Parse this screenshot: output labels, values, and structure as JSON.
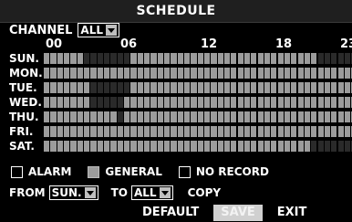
{
  "title": "SCHEDULE",
  "channel": {
    "label": "CHANNEL",
    "value": "ALL"
  },
  "hours": [
    "00",
    "06",
    "12",
    "18",
    "23"
  ],
  "days": [
    {
      "label": "SUN.",
      "cells": "GGGGGGAAAAAAAGGGGGGGGGGGGGGGGGGGGGGGGGGGGAAAAAA"
    },
    {
      "label": "MON.",
      "cells": "GGGGGGGGGGGGGGGGGGGGGGGGGGGGGGGGGGGGGGGGGGGGGGG"
    },
    {
      "label": "TUE.",
      "cells": "GGGGGGGAAAAAAGGGGGGGGGGGGGGGGGGGGGGGGGGGGGGGGGG"
    },
    {
      "label": "WED.",
      "cells": "GGGGGGGAAAAAGGGGGGGGGGGGGGGGGGGGGGGGGGGGGGGGGGG"
    },
    {
      "label": "THU.",
      "cells": "GGGGGGGGGGGAGGGGGGGGGGGGGGGGGGGGGGGGGGGGGGGGGGG"
    },
    {
      "label": "FRI.",
      "cells": "GGGGGGGGGGGGGGGGGGGGGGGGGGGGGGGGGGGGGGGGGGGGGGG"
    },
    {
      "label": "SAT.",
      "cells": "GGGGGGGGGGGGGGGGGGGGGGGGGGGGGGGGGGGGGGGGAAAAAAA"
    }
  ],
  "legend": {
    "alarm": "ALARM",
    "general": "GENERAL",
    "no_record": "NO RECORD"
  },
  "copy_row": {
    "from_label": "FROM",
    "from_value": "SUN.",
    "to_label": "TO",
    "to_value": "ALL",
    "copy_label": "COPY"
  },
  "buttons": {
    "default": "DEFAULT",
    "save": "SAVE",
    "exit": "EXIT"
  },
  "colors": {
    "general": "#9c9c9c",
    "alarm": "#2a2a2a",
    "selected_button": "#d0d0d0"
  }
}
